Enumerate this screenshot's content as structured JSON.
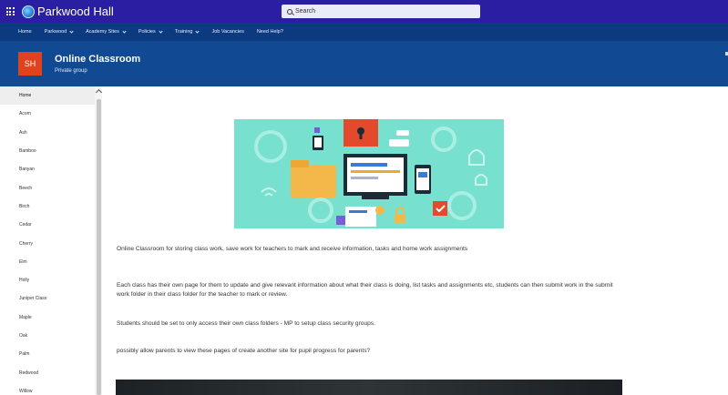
{
  "suite": {
    "brand": "Parkwood Hall",
    "search_placeholder": "Search",
    "icons": {
      "app_launcher": "waffle-icon",
      "search": "search-icon",
      "brand_logo": "globe-logo-icon"
    }
  },
  "hubnav": {
    "items": [
      {
        "label": "Home",
        "dropdown": false
      },
      {
        "label": "Parkwood",
        "dropdown": true
      },
      {
        "label": "Academy Sites",
        "dropdown": true
      },
      {
        "label": "Policies",
        "dropdown": true
      },
      {
        "label": "Training",
        "dropdown": true
      },
      {
        "label": "Job Vacancies",
        "dropdown": false
      },
      {
        "label": "Need Help?",
        "dropdown": false
      }
    ]
  },
  "site": {
    "logo_initials": "SH",
    "title": "Online Classroom",
    "subtitle": "Private group"
  },
  "leftnav": {
    "items": [
      "Home",
      "Acorn",
      "Ash",
      "Bamboo",
      "Banyan",
      "Beech",
      "Birch",
      "Cedar",
      "Cherry",
      "Elm",
      "Holly",
      "Juniper Class",
      "Maple",
      "Oak",
      "Palm",
      "Redwood",
      "Willow"
    ],
    "active_index": 0
  },
  "content": {
    "paragraphs": [
      "Online Classroom for storing class work, save work for teachers to mark and receive information, tasks and home work assignments",
      "Each class has their own page for them to update and give relevant information about what their class is doing, list tasks and assignments etc, students can then submit work in the submit work folder in their class folder for the teacher to mark or review.",
      "Students should be set to only access their own class folders - MP to setup class security groups.",
      "possibly allow parents to view these pages of create another site for pupil progress for parents?"
    ]
  },
  "colors": {
    "suitebar": "#2a1fa3",
    "hubnav": "#0b3a7e",
    "site_header": "#114a92",
    "site_logo": "#e0431b",
    "hero_background": "#77e0cf"
  }
}
